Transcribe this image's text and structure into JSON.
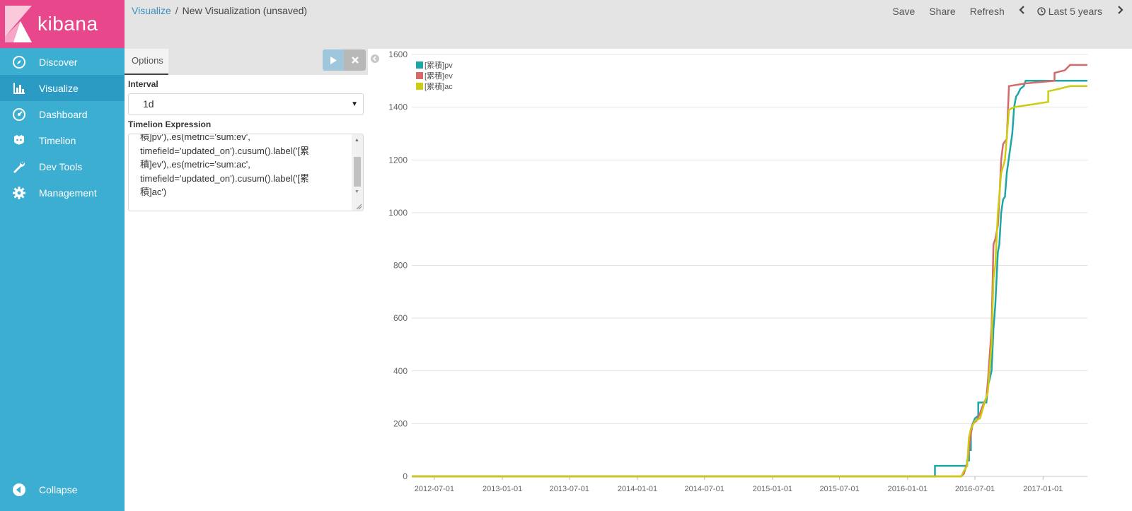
{
  "app": {
    "name": "kibana"
  },
  "sidebar": {
    "items": [
      {
        "label": "Discover",
        "icon": "compass-icon"
      },
      {
        "label": "Visualize",
        "icon": "bar-chart-icon"
      },
      {
        "label": "Dashboard",
        "icon": "gauge-icon"
      },
      {
        "label": "Timelion",
        "icon": "timelion-icon"
      },
      {
        "label": "Dev Tools",
        "icon": "wrench-icon"
      },
      {
        "label": "Management",
        "icon": "gear-icon"
      }
    ],
    "active": "Visualize",
    "collapse_label": "Collapse"
  },
  "breadcrumb": {
    "parent": "Visualize",
    "sep": "/",
    "current": "New Visualization (unsaved)"
  },
  "toolbar": {
    "save": "Save",
    "share": "Share",
    "refresh": "Refresh",
    "time": "Last 5 years"
  },
  "panel": {
    "tab": "Options",
    "interval_label": "Interval",
    "interval_value": "1d",
    "expression_label": "Timelion Expression",
    "expression_text": "積]pv'),.es(metric='sum:ev',\ntimefield='updated_on').cusum().label('[累\n積]ev'),.es(metric='sum:ac',\ntimefield='updated_on').cusum().label('[累\n積]ac')"
  },
  "colors": {
    "pv": "#1ea5a5",
    "ev": "#d46a6a",
    "ac": "#cccc10",
    "sidebar": "#3caed2",
    "logo": "#e8488b"
  },
  "chart_data": {
    "type": "line",
    "ylim": [
      0,
      1600
    ],
    "yticks": [
      0,
      200,
      400,
      600,
      800,
      1000,
      1200,
      1400,
      1600
    ],
    "xticks": [
      "2012-07-01",
      "2013-01-01",
      "2013-07-01",
      "2014-01-01",
      "2014-07-01",
      "2015-01-01",
      "2015-07-01",
      "2016-01-01",
      "2016-07-01",
      "2017-01-01"
    ],
    "xlim": [
      "2012-05-01",
      "2017-05-01"
    ],
    "series": [
      {
        "name": "[累積]pv",
        "color": "#1ea5a5",
        "points": [
          [
            "2012-05-01",
            0
          ],
          [
            "2016-03-15",
            0
          ],
          [
            "2016-03-15",
            40
          ],
          [
            "2016-06-10",
            40
          ],
          [
            "2016-06-10",
            60
          ],
          [
            "2016-06-15",
            60
          ],
          [
            "2016-06-15",
            100
          ],
          [
            "2016-06-20",
            100
          ],
          [
            "2016-06-20",
            180
          ],
          [
            "2016-06-25",
            200
          ],
          [
            "2016-07-01",
            220
          ],
          [
            "2016-07-10",
            230
          ],
          [
            "2016-07-10",
            280
          ],
          [
            "2016-08-01",
            280
          ],
          [
            "2016-08-05",
            340
          ],
          [
            "2016-08-15",
            400
          ],
          [
            "2016-08-20",
            560
          ],
          [
            "2016-08-25",
            650
          ],
          [
            "2016-09-01",
            850
          ],
          [
            "2016-09-05",
            880
          ],
          [
            "2016-09-10",
            1000
          ],
          [
            "2016-09-15",
            1050
          ],
          [
            "2016-09-20",
            1060
          ],
          [
            "2016-09-25",
            1150
          ],
          [
            "2016-09-30",
            1200
          ],
          [
            "2016-10-10",
            1300
          ],
          [
            "2016-10-15",
            1400
          ],
          [
            "2016-10-20",
            1440
          ],
          [
            "2016-10-25",
            1450
          ],
          [
            "2016-11-01",
            1470
          ],
          [
            "2016-11-10",
            1480
          ],
          [
            "2016-11-15",
            1500
          ],
          [
            "2017-05-01",
            1500
          ]
        ]
      },
      {
        "name": "[累積]ev",
        "color": "#d46a6a",
        "points": [
          [
            "2012-05-01",
            0
          ],
          [
            "2016-05-25",
            0
          ],
          [
            "2016-06-01",
            10
          ],
          [
            "2016-06-10",
            50
          ],
          [
            "2016-06-15",
            100
          ],
          [
            "2016-06-20",
            160
          ],
          [
            "2016-06-25",
            200
          ],
          [
            "2016-07-05",
            210
          ],
          [
            "2016-07-15",
            240
          ],
          [
            "2016-07-20",
            260
          ],
          [
            "2016-08-01",
            300
          ],
          [
            "2016-08-05",
            360
          ],
          [
            "2016-08-15",
            560
          ],
          [
            "2016-08-20",
            880
          ],
          [
            "2016-08-25",
            900
          ],
          [
            "2016-09-01",
            950
          ],
          [
            "2016-09-05",
            1050
          ],
          [
            "2016-09-10",
            1200
          ],
          [
            "2016-09-15",
            1260
          ],
          [
            "2016-09-25",
            1280
          ],
          [
            "2016-10-01",
            1480
          ],
          [
            "2016-11-15",
            1490
          ],
          [
            "2017-02-01",
            1500
          ],
          [
            "2017-02-01",
            1530
          ],
          [
            "2017-03-01",
            1540
          ],
          [
            "2017-03-15",
            1560
          ],
          [
            "2017-05-01",
            1560
          ]
        ]
      },
      {
        "name": "[累積]ac",
        "color": "#cccc10",
        "points": [
          [
            "2012-05-01",
            0
          ],
          [
            "2016-05-25",
            0
          ],
          [
            "2016-06-01",
            20
          ],
          [
            "2016-06-10",
            40
          ],
          [
            "2016-06-15",
            150
          ],
          [
            "2016-06-20",
            180
          ],
          [
            "2016-07-01",
            210
          ],
          [
            "2016-07-15",
            220
          ],
          [
            "2016-07-25",
            270
          ],
          [
            "2016-08-05",
            320
          ],
          [
            "2016-08-15",
            500
          ],
          [
            "2016-08-20",
            750
          ],
          [
            "2016-08-25",
            800
          ],
          [
            "2016-09-01",
            1000
          ],
          [
            "2016-09-10",
            1150
          ],
          [
            "2016-09-20",
            1200
          ],
          [
            "2016-10-01",
            1390
          ],
          [
            "2016-10-15",
            1400
          ],
          [
            "2016-12-01",
            1410
          ],
          [
            "2017-01-15",
            1420
          ],
          [
            "2017-01-15",
            1460
          ],
          [
            "2017-02-15",
            1470
          ],
          [
            "2017-03-15",
            1480
          ],
          [
            "2017-05-01",
            1480
          ]
        ]
      }
    ]
  }
}
